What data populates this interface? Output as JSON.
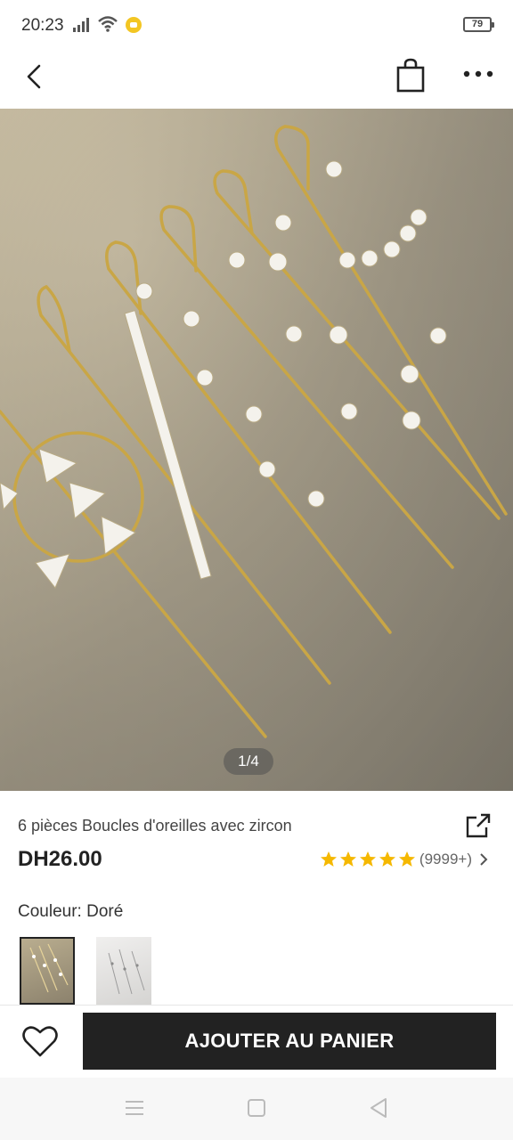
{
  "status_bar": {
    "time": "20:23",
    "battery": "79"
  },
  "nav": {
    "back_icon": "chevron-left-icon",
    "bag_icon": "shopping-bag-icon",
    "more_icon": "more-dots-icon"
  },
  "gallery": {
    "pager": "1/4"
  },
  "product": {
    "title": "6 pièces Boucles d'oreilles avec zircon",
    "price": "DH26.00",
    "rating_stars": 5,
    "review_count": "(9999+)",
    "color_label": "Couleur: Doré"
  },
  "cart": {
    "add_label": "AJOUTER AU PANIER"
  },
  "colors": {
    "star": "#f5b800",
    "button_bg": "#222222"
  }
}
